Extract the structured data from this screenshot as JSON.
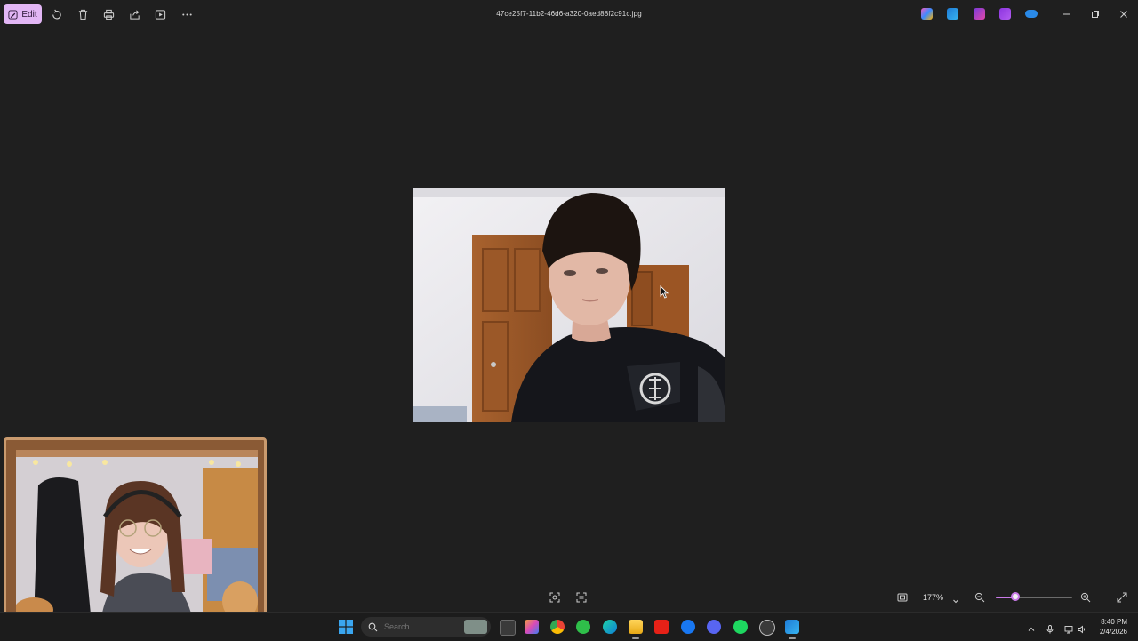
{
  "toolbar": {
    "edit_label": "Edit",
    "filename": "47ce25f7-11b2-46d6-a320-0aed88f2c91c.jpg",
    "tools": [
      "rotate-icon",
      "delete-icon",
      "print-icon",
      "share-icon",
      "slideshow-icon",
      "more-icon"
    ],
    "app_icons": [
      "copilot-icon",
      "designer-icon",
      "clipchamp-icon",
      "onedrive-icon"
    ]
  },
  "viewer": {
    "zoom_label": "177%",
    "zoom_level": 0.25
  },
  "taskbar": {
    "search_placeholder": "Search",
    "clock_time": "8:40 PM",
    "clock_date": "2/4/2026"
  },
  "colors": {
    "background": "#1f1f1f",
    "accent": "#c97ae8",
    "edit_button": "#e2b6f5",
    "taskbar": "#1c1c1c"
  }
}
